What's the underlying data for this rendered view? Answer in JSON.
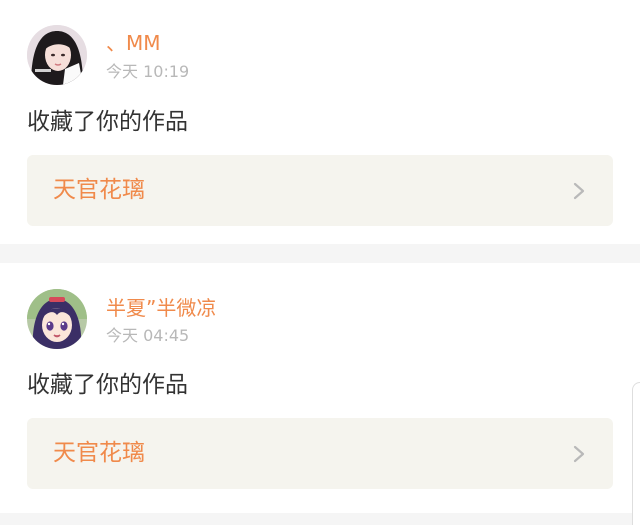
{
  "notifications": [
    {
      "username": "、MM",
      "time": "今天 10:19",
      "action": "收藏了你的作品",
      "work_title": "天官花璃",
      "avatar_icon": "user-avatar-girl-photo-icon"
    },
    {
      "username": "半夏”半微凉",
      "time": "今天 04:45",
      "action": "收藏了你的作品",
      "work_title": "天官花璃",
      "avatar_icon": "user-avatar-anime-icon"
    }
  ],
  "colors": {
    "accent": "#f08a4b",
    "time_gray": "#b8b8b8",
    "text_dark": "#333333",
    "work_bg": "#f5f4ee",
    "page_bg": "#f5f5f5"
  }
}
